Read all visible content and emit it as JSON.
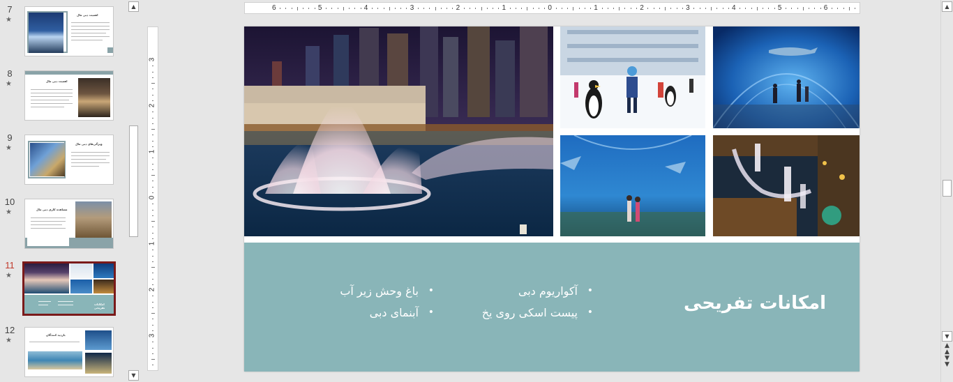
{
  "thumbnails": [
    {
      "number": "7",
      "star": "★",
      "title": "اهمیت دبی مال"
    },
    {
      "number": "8",
      "star": "★",
      "title": "اهمیت دبی مال"
    },
    {
      "number": "9",
      "star": "★",
      "title": "ویژگی‌های دبی مال"
    },
    {
      "number": "10",
      "star": "★",
      "title": "مشاهده کاری دبی مال"
    },
    {
      "number": "11",
      "star": "★",
      "title": "امکانات تفریحی"
    },
    {
      "number": "12",
      "star": "★",
      "title": "بازدید کنندگان"
    }
  ],
  "active_slide": "11",
  "ruler": {
    "horizontal_labels": [
      "6",
      "5",
      "4",
      "3",
      "2",
      "1",
      "0",
      "1",
      "2",
      "3",
      "4",
      "5",
      "6"
    ],
    "vertical_labels": [
      "3",
      "2",
      "1",
      "0",
      "1",
      "2",
      "3"
    ]
  },
  "slide": {
    "title": "امکانات تفریحی",
    "bullets_right": [
      "آکواریوم دبی",
      "پیست اسکی روی یخ"
    ],
    "bullets_left": [
      "باغ وحش زیر آب",
      "آبنمای دبی"
    ],
    "band_color": "#89b5b8",
    "photos": [
      {
        "name": "dubai-fountain-night",
        "alt": ""
      },
      {
        "name": "ice-rink-penguin",
        "alt": ""
      },
      {
        "name": "aquarium-tunnel-shark",
        "alt": ""
      },
      {
        "name": "aquarium-big-tank",
        "alt": ""
      },
      {
        "name": "fountain-aerial-night",
        "alt": ""
      }
    ]
  },
  "scrollbar": {
    "up_arrow": "▲",
    "down_arrow": "▼",
    "prev_slide_icon": "double-up-icon",
    "next_slide_icon": "double-down-icon"
  }
}
